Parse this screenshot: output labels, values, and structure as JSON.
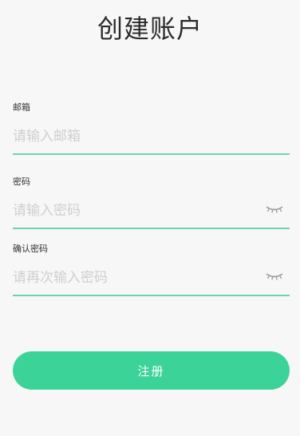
{
  "page": {
    "title": "创建账户"
  },
  "form": {
    "email": {
      "label": "邮箱",
      "placeholder": "请输入邮箱",
      "value": ""
    },
    "password": {
      "label": "密码",
      "placeholder": "请输入密码",
      "value": "",
      "visibility_icon": "eye-closed-icon"
    },
    "confirm_password": {
      "label": "确认密码",
      "placeholder": "请再次输入密码",
      "value": "",
      "visibility_icon": "eye-closed-icon"
    },
    "submit_label": "注册"
  },
  "colors": {
    "accent": "#3cd398",
    "underline": "#6fd3ad",
    "background": "#f7f7f7",
    "placeholder": "#cfcfcf"
  }
}
